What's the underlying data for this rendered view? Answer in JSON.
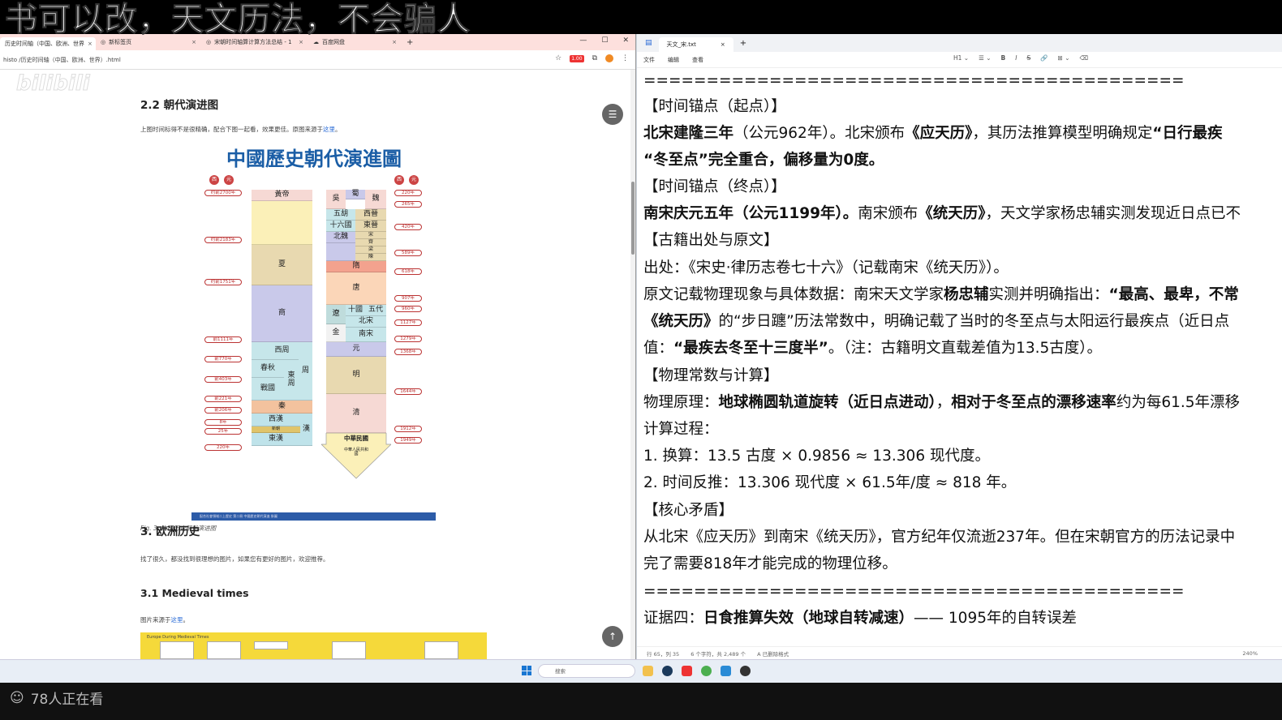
{
  "banner": {
    "text": "书可以改，天文历法，不会骗人"
  },
  "watermark": "bilibili",
  "browser": {
    "tabs": [
      {
        "label": "历史时间轴（中国、欧洲、世界",
        "close": "×"
      },
      {
        "label": "新标签页",
        "close": "×"
      },
      {
        "label": "宋朝时间轴算计算方法总结 - 1",
        "close": "×"
      },
      {
        "label": "百度网盘",
        "close": "×"
      }
    ],
    "new_tab": "+",
    "controls": {
      "min": "—",
      "max": "☐",
      "close": "✕"
    },
    "address": "histo  /历史时间轴（中国、欧洲、世界）.html",
    "badge": "1.00",
    "page": {
      "h_dynasty": "2.2 朝代演进图",
      "dynasty_desc": "上图时间标得不是很精确，配合下图一起看，效果更佳。原图来源于",
      "dynasty_link": "这里",
      "dynasty_desc_end": "。",
      "chart_title": "中國歷史朝代演進圖",
      "seals_left": [
        "西",
        "元"
      ],
      "seals_right": [
        "西",
        "元"
      ],
      "left_years": [
        "约前2700年",
        "约前2183年",
        "约前1751年",
        "前1111年",
        "前770年",
        "前403年",
        "前221年",
        "前206年",
        "8年",
        "25年",
        "220年"
      ],
      "right_years": [
        "220年",
        "265年",
        "420年",
        "589年",
        "618年",
        "907年",
        "960年",
        "1127年",
        "1279年",
        "1368年",
        "1644年",
        "1912年",
        "1949年"
      ],
      "left_col": [
        "黃帝",
        "夏",
        "商",
        "西周",
        "春秋",
        "戰國",
        "秦",
        "西漢",
        "新朝",
        "東漢"
      ],
      "left_side": [
        "東",
        "周",
        "周",
        "漢"
      ],
      "right_col": [
        "吳",
        "蜀",
        "魏",
        "五胡",
        "十六國",
        "西晉",
        "東晉",
        "北魏",
        "宋",
        "齊",
        "梁",
        "陳",
        "隋",
        "唐",
        "十國",
        "五代",
        "遼",
        "北宋",
        "金",
        "南宋",
        "元",
        "明",
        "清",
        "中華民國",
        "中華人民共和國"
      ],
      "chart_footer": "配合社會領域二上歷史 第二冊 中國歷史朝代演進 掛圖",
      "caption": "Fig. 3: 中国历史朝代演进图",
      "h_europe": "3. 欧洲历史",
      "europe_desc": "找了很久，都没找到很理想的图片，如果您有更好的图片，欢迎推荐。",
      "h_medieval": "3.1 Medieval times",
      "medieval_desc": "图片来源于",
      "medieval_link": "这里",
      "medieval_desc_end": "。",
      "medieval_img_title": "Europe During Medieval Times"
    }
  },
  "editor": {
    "tab": "天文_宋.txt",
    "tab_close": "×",
    "new_tab": "+",
    "menu": [
      "文件",
      "编辑",
      "查看"
    ],
    "tools": [
      "H1 ⌄",
      "☰ ⌄",
      "B",
      "I",
      "S",
      "🔗",
      "⊞ ⌄",
      "⌫"
    ],
    "lines": [
      {
        "type": "plain",
        "text": "==========================================="
      },
      {
        "type": "plain",
        "text": "【时间锚点（起点）】"
      },
      {
        "type": "mix",
        "parts": [
          [
            "b",
            "北宋建隆三年"
          ],
          [
            "n",
            "（公元962年）。北宋颁布"
          ],
          [
            "b",
            "《应天历》"
          ],
          [
            "n",
            "，其历法推算模型明确规定"
          ],
          [
            "b",
            "“日行最疾"
          ]
        ]
      },
      {
        "type": "mix",
        "parts": [
          [
            "b",
            "“冬至点”完全重合，偏移量为0度。"
          ]
        ]
      },
      {
        "type": "plain",
        "text": "【时间锚点（终点）】"
      },
      {
        "type": "mix",
        "parts": [
          [
            "b",
            "南宋庆元五年（公元1199年）。"
          ],
          [
            "n",
            "南宋颁布"
          ],
          [
            "b",
            "《统天历》"
          ],
          [
            "n",
            "，天文学家杨忠辅实测发现近日点已不"
          ]
        ]
      },
      {
        "type": "plain",
        "text": "【古籍出处与原文】"
      },
      {
        "type": "plain",
        "text": "出处：《宋史·律历志卷七十六》（记载南宋《统天历》）。"
      },
      {
        "type": "mix",
        "parts": [
          [
            "n",
            "原文记载物理现象与具体数据：南宋天文学家"
          ],
          [
            "b",
            "杨忠辅"
          ],
          [
            "n",
            "实测并明确指出："
          ],
          [
            "b",
            "“最高、最卑，不常"
          ]
        ]
      },
      {
        "type": "mix",
        "parts": [
          [
            "b",
            "《统天历》"
          ],
          [
            "n",
            "的“步日躔”历法常数中，明确记载了当时的冬至点与太阳运行最疾点（近日点"
          ]
        ]
      },
      {
        "type": "mix",
        "parts": [
          [
            "n",
            "值："
          ],
          [
            "b",
            "“最疾去冬至十三度半”"
          ],
          [
            "n",
            "。（注：古籍明文直载差值为13.5古度）。"
          ]
        ]
      },
      {
        "type": "plain",
        "text": "【物理常数与计算】"
      },
      {
        "type": "mix",
        "parts": [
          [
            "n",
            "物理原理："
          ],
          [
            "b",
            "地球椭圆轨道旋转（近日点进动）"
          ],
          [
            "n",
            "，"
          ],
          [
            "b",
            "相对于冬至点的漂移速率"
          ],
          [
            "n",
            "约为每61.5年漂移"
          ]
        ]
      },
      {
        "type": "plain",
        "text": "计算过程："
      },
      {
        "type": "plain",
        "text": "1. 换算：13.5 古度 × 0.9856 ≈ 13.306 现代度。"
      },
      {
        "type": "plain",
        "text": "2. 时间反推：13.306 现代度 × 61.5年/度 ≈ 818 年。"
      },
      {
        "type": "plain",
        "text": "【核心矛盾】"
      },
      {
        "type": "plain",
        "text": "从北宋《应天历》到南宋《统天历》，官方纪年仅流逝237年。但在宋朝官方的历法记录中"
      },
      {
        "type": "plain",
        "text": "完了需要818年才能完成的物理位移。"
      },
      {
        "type": "plain",
        "text": "==========================================="
      },
      {
        "type": "mix",
        "parts": [
          [
            "n",
            "证据四："
          ],
          [
            "b",
            "日食推算失效（地球自转减速）"
          ],
          [
            "n",
            "—— 1095年的自转误差"
          ]
        ]
      }
    ],
    "status": [
      "行 65，列 35",
      "6 个字符，共 2,489 个",
      "A  已删除格式"
    ],
    "zoom": "240%"
  },
  "taskbar": {
    "search": "搜索"
  },
  "viewers": "78人正在看",
  "colors": {
    "accent": "#1b5ea6",
    "tabbar": "#fde0dd",
    "link": "#2a6bd6"
  }
}
